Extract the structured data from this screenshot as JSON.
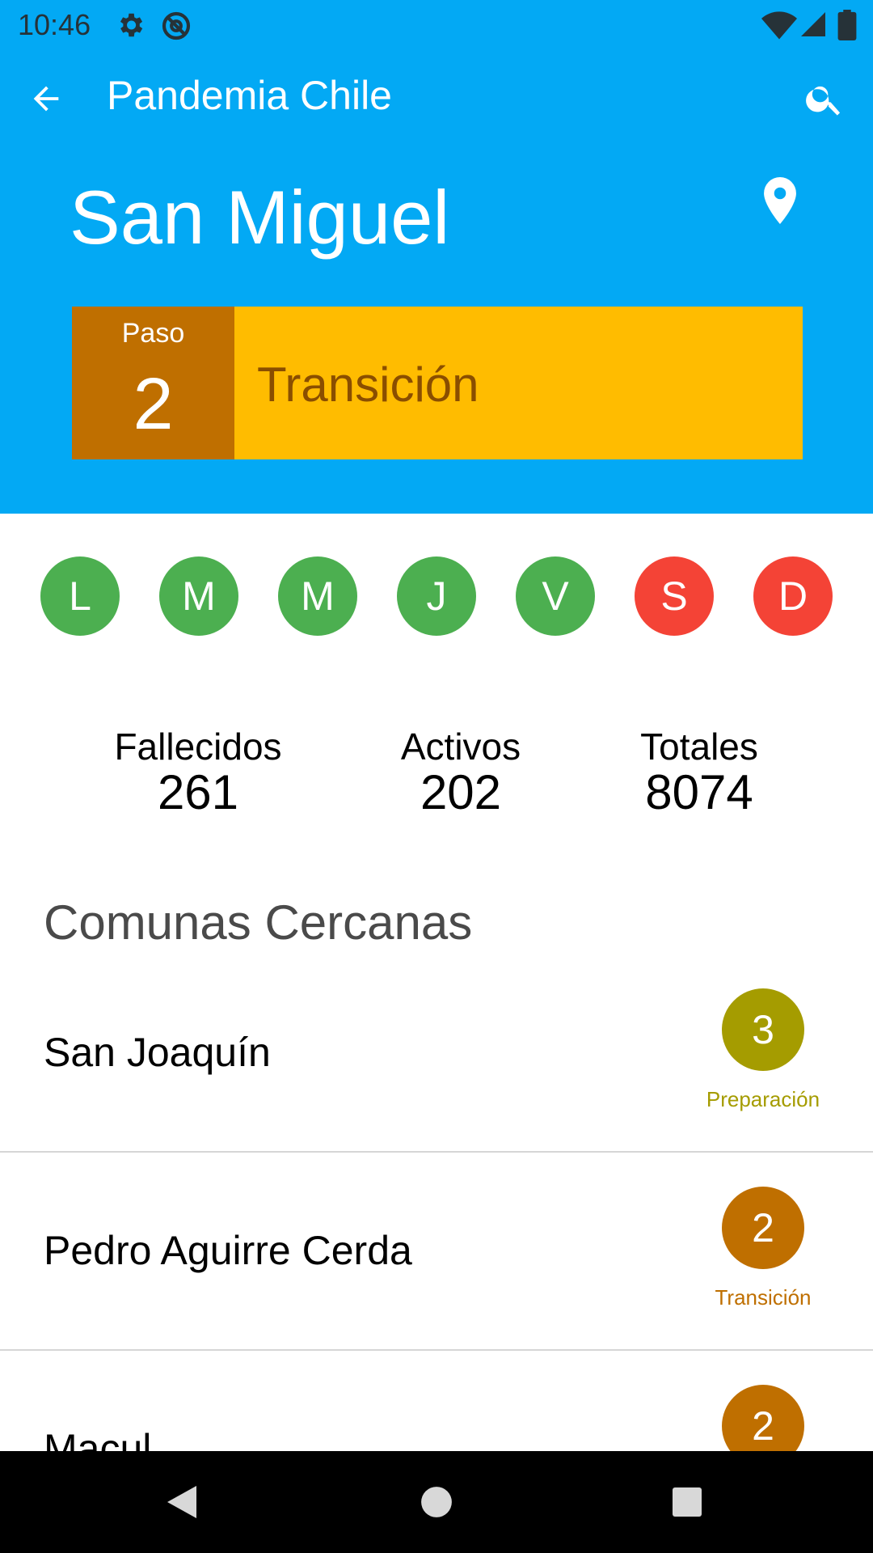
{
  "status_bar": {
    "time": "10:46"
  },
  "app_bar": {
    "title": "Pandemia Chile"
  },
  "commune": {
    "name": "San Miguel",
    "phase_label": "Paso",
    "phase_number": "2",
    "phase_name": "Transición",
    "colors": {
      "phase_box": "#bf6f00",
      "phase_bar": "#ffbc00",
      "phase_text": "#8a4e00"
    }
  },
  "days": [
    {
      "letter": "L",
      "color": "#4caf50"
    },
    {
      "letter": "M",
      "color": "#4caf50"
    },
    {
      "letter": "M",
      "color": "#4caf50"
    },
    {
      "letter": "J",
      "color": "#4caf50"
    },
    {
      "letter": "V",
      "color": "#4caf50"
    },
    {
      "letter": "S",
      "color": "#f44336"
    },
    {
      "letter": "D",
      "color": "#f44336"
    }
  ],
  "stats": {
    "deaths": {
      "label": "Fallecidos",
      "value": "261"
    },
    "active": {
      "label": "Activos",
      "value": "202"
    },
    "total": {
      "label": "Totales",
      "value": "8074"
    }
  },
  "nearby": {
    "title": "Comunas Cercanas",
    "items": [
      {
        "name": "San Joaquín",
        "phase_number": "3",
        "phase_name": "Preparación",
        "color": "#a59c00"
      },
      {
        "name": "Pedro Aguirre Cerda",
        "phase_number": "2",
        "phase_name": "Transición",
        "color": "#bf6f00"
      },
      {
        "name": "Macul",
        "phase_number": "2",
        "phase_name": "",
        "color": "#bf6f00"
      }
    ]
  },
  "colors": {
    "primary": "#03a9f4",
    "nav_bar": "#000000"
  }
}
